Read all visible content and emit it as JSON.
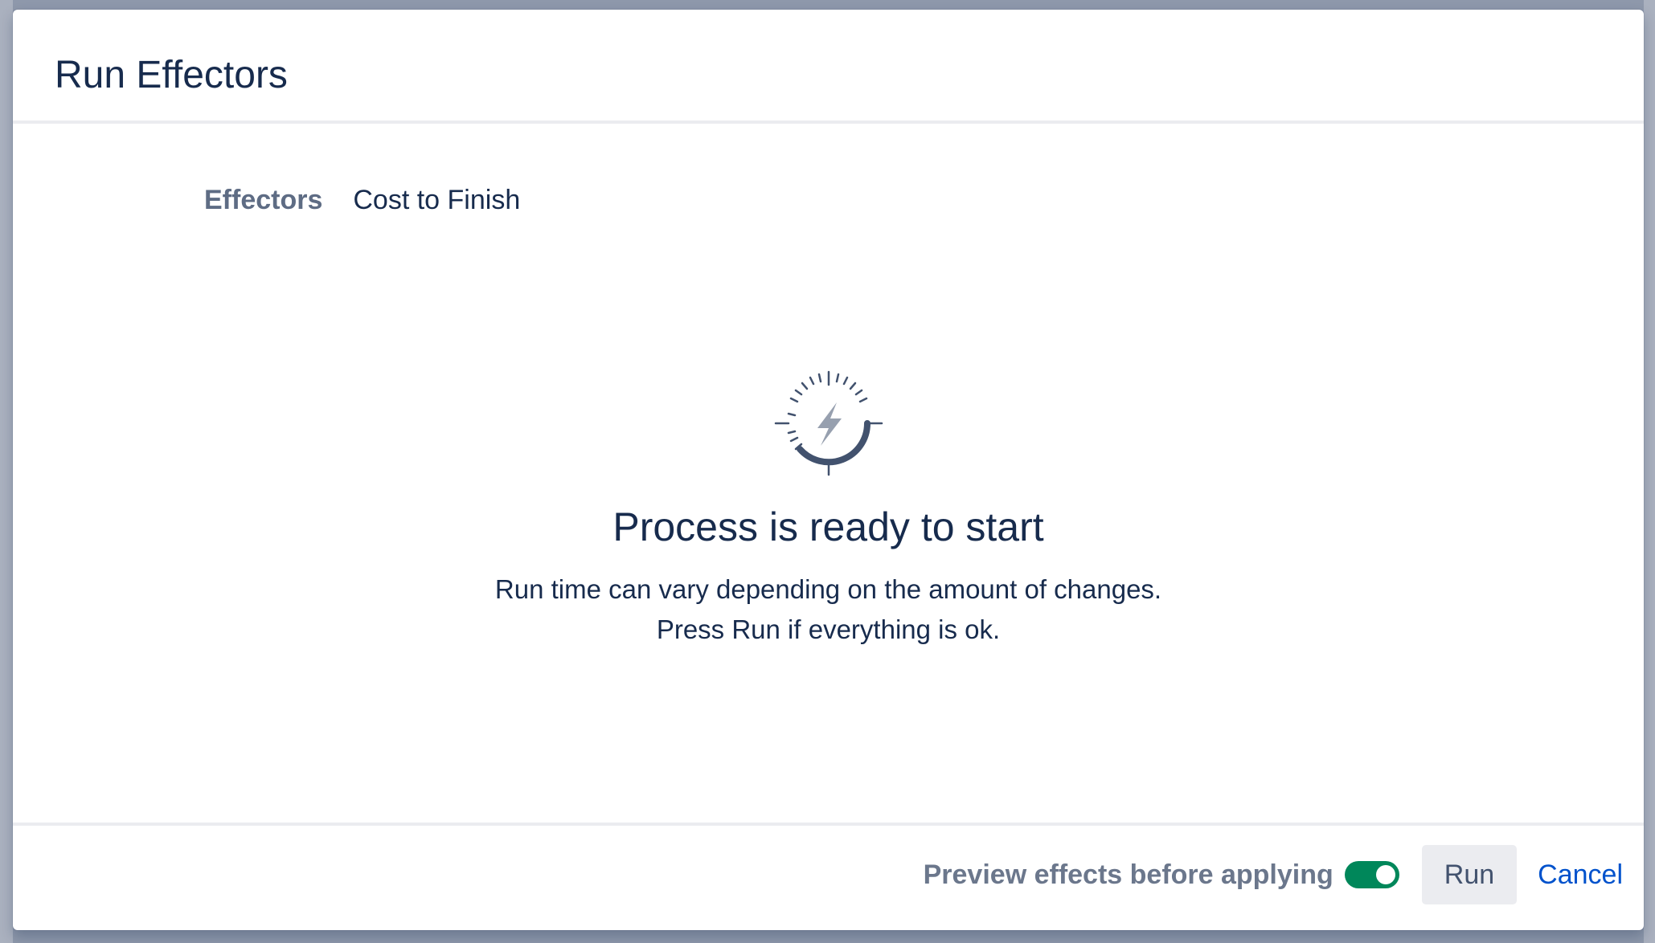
{
  "modal": {
    "title": "Run Effectors"
  },
  "tabs": [
    {
      "label": "Effectors",
      "active": true
    },
    {
      "label": "Cost to Finish",
      "active": false
    }
  ],
  "status": {
    "icon": "stopwatch-lightning-icon",
    "headline": "Process is ready to start",
    "line1": "Run time can vary depending on the amount of changes.",
    "line2": "Press Run if everything is ok."
  },
  "footer": {
    "preview_label": "Preview effects before applying",
    "preview_enabled": true,
    "run_label": "Run",
    "cancel_label": "Cancel"
  },
  "colors": {
    "toggle_on": "#00875a",
    "link": "#0052cc",
    "text": "#172b4d"
  }
}
